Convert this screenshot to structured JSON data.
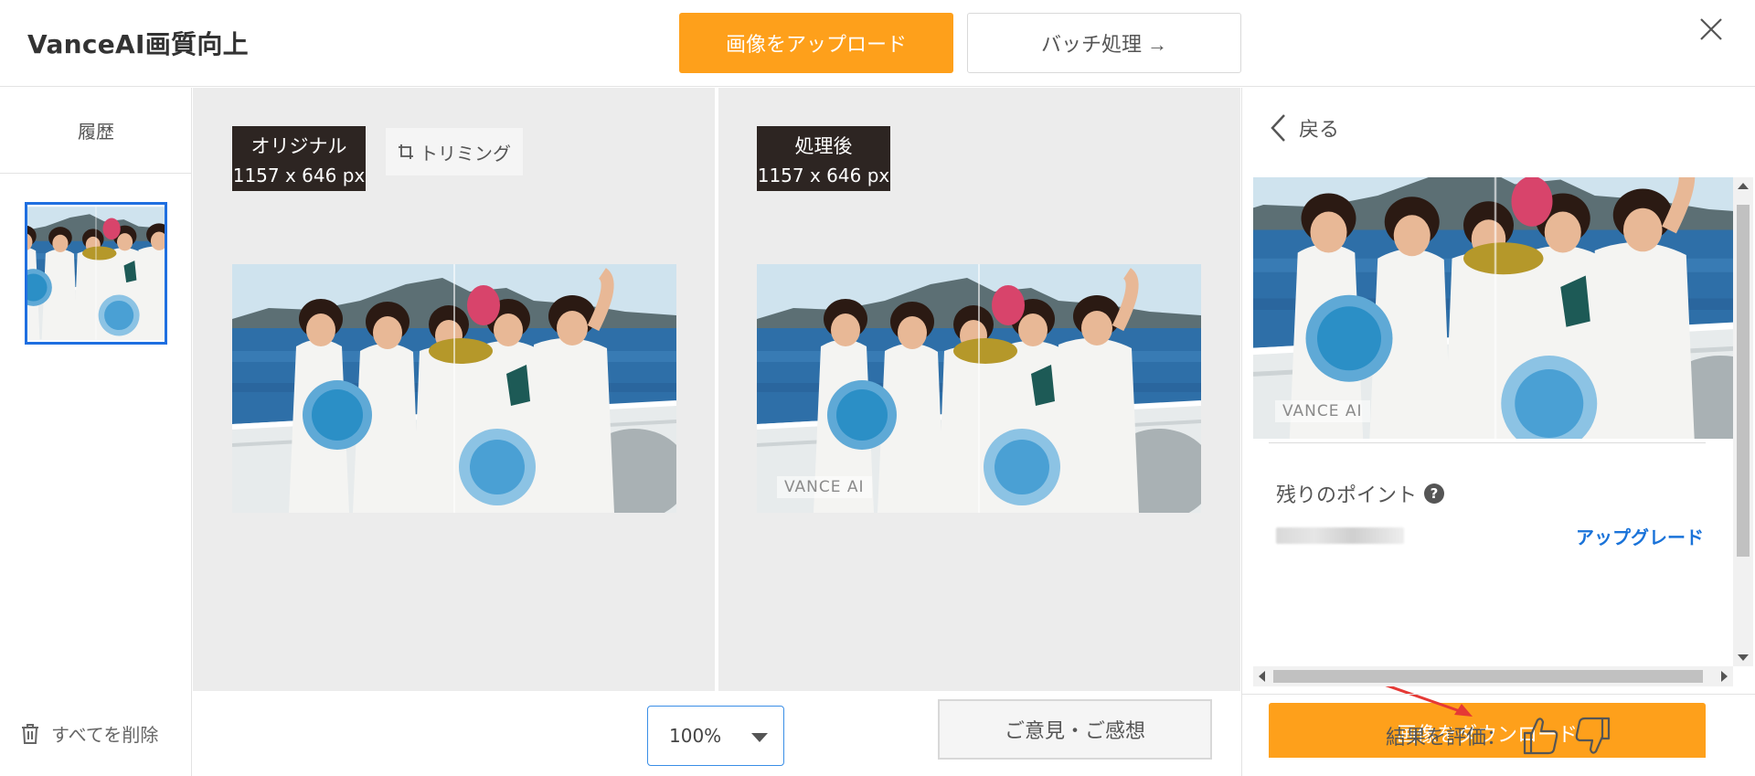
{
  "header": {
    "app_title": "VanceAI画質向上",
    "upload_label": "画像をアップロード",
    "batch_label": "バッチ処理 →",
    "accent_color": "#fea01b"
  },
  "sidebar": {
    "history_label": "履歴",
    "delete_all_label": "すべてを削除"
  },
  "compare": {
    "original": {
      "title": "オリジナル",
      "size": "1157 x 646 px"
    },
    "trim_label": "トリミング",
    "processed": {
      "title": "処理後",
      "size": "1157 x 646 px"
    },
    "watermark": "VANCE AI"
  },
  "bottom": {
    "zoom_value": "100%",
    "feedback_label": "ご意見・ご感想"
  },
  "right_panel": {
    "back_label": "戻る",
    "watermark": "VANCE AI",
    "points_label": "残りのポイント",
    "help_symbol": "?",
    "upgrade_label": "アップグレード",
    "download_label": "画像をダウンロード",
    "rate_label": "結果を評価："
  }
}
